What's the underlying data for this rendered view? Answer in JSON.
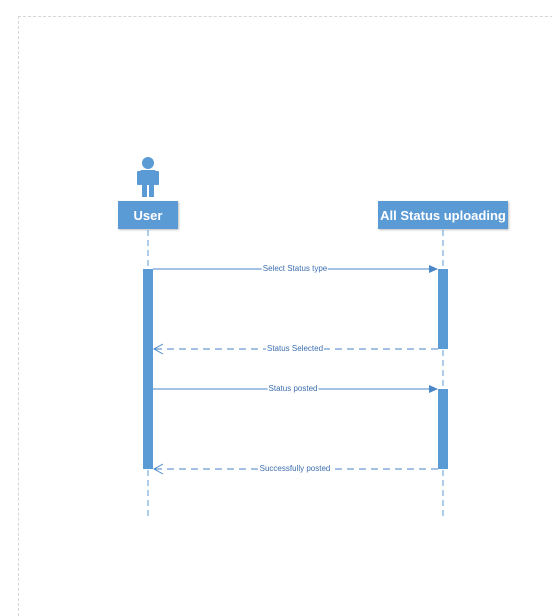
{
  "diagram": {
    "accent_color": "#5b9bd5",
    "line_color": "#4a86c8",
    "actor_icon": "person-icon",
    "lifelines": [
      {
        "id": "user",
        "label": "User"
      },
      {
        "id": "system",
        "label": "All Status uploading"
      }
    ],
    "messages": [
      {
        "label": "Select Status type",
        "from": "user",
        "to": "system",
        "style": "solid"
      },
      {
        "label": "Status Selected",
        "from": "system",
        "to": "user",
        "style": "dashed"
      },
      {
        "label": "Status posted",
        "from": "user",
        "to": "system",
        "style": "solid"
      },
      {
        "label": "Successfully posted",
        "from": "system",
        "to": "user",
        "style": "dashed"
      }
    ]
  }
}
